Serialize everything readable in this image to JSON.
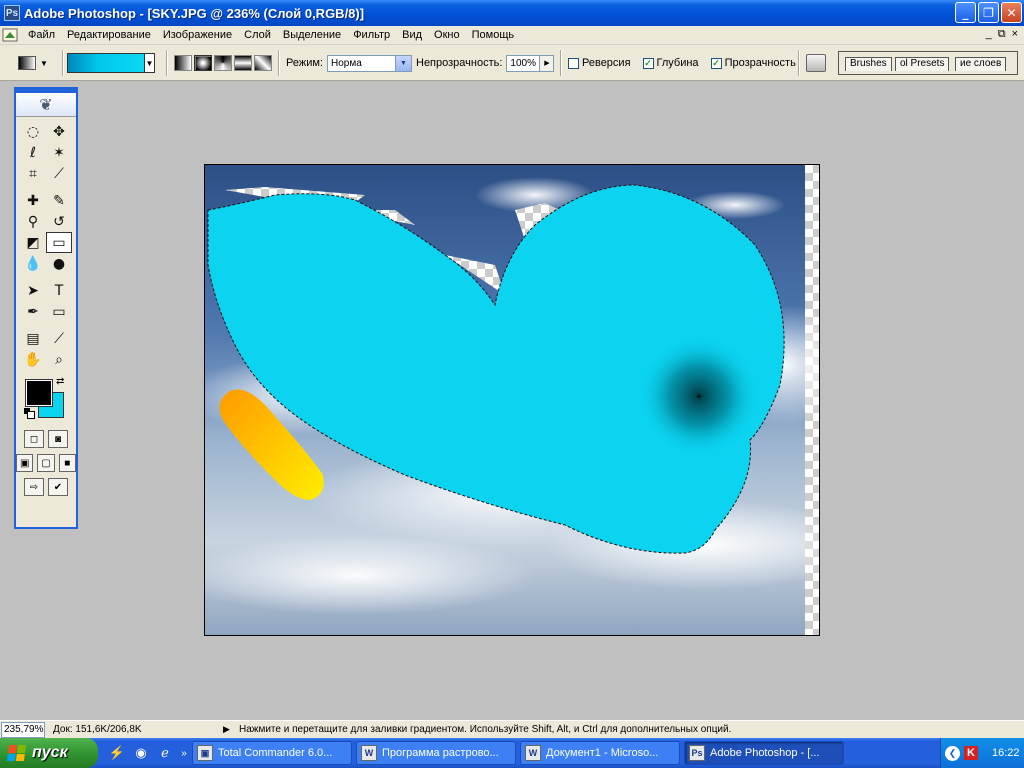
{
  "window": {
    "title": "Adobe Photoshop - [SKY.JPG @ 236% (Слой 0,RGB/8)]",
    "minimize_icon": "minimize-icon",
    "restore_icon": "restore-icon",
    "close_icon": "close-icon"
  },
  "menu": {
    "items": [
      "Файл",
      "Редактирование",
      "Изображение",
      "Слой",
      "Выделение",
      "Фильтр",
      "Вид",
      "Окно",
      "Помощь"
    ],
    "doc_buttons": [
      "_",
      "⧉",
      "×"
    ]
  },
  "options": {
    "mode_label": "Режим:",
    "mode_value": "Норма",
    "opacity_label": "Непрозрачность:",
    "opacity_value": "100%",
    "reverse_label": "Реверсия",
    "reverse_checked": false,
    "dither_label": "Глубина",
    "dither_checked": true,
    "transparency_label": "Прозрачность",
    "transparency_checked": true,
    "gradient_colors": [
      "#0087b8",
      "#0bd8f4"
    ],
    "palette_tabs": [
      "Brushes",
      "ol Presets",
      "ие слоев"
    ]
  },
  "toolbox": {
    "foreground_color": "#000000",
    "background_color": "#0bd3f0"
  },
  "status": {
    "zoom": "235,79%",
    "doc_info": "Док: 151,6K/206,8K",
    "hint": "Нажмите и перетащите для заливки градиентом. Используйте Shift, Alt, и Ctrl для дополнительных опций."
  },
  "taskbar": {
    "start_label": "пуск",
    "tasks": [
      {
        "label": "Total Commander 6.0...",
        "active": false
      },
      {
        "label": "Программа растрово...",
        "active": false
      },
      {
        "label": "Документ1 - Microso...",
        "active": false
      },
      {
        "label": "Adobe Photoshop - [...",
        "active": true
      }
    ],
    "clock": "16:22"
  },
  "canvas": {
    "fill_color": "#0bd3f0",
    "stroke_color": "#ffb000"
  }
}
